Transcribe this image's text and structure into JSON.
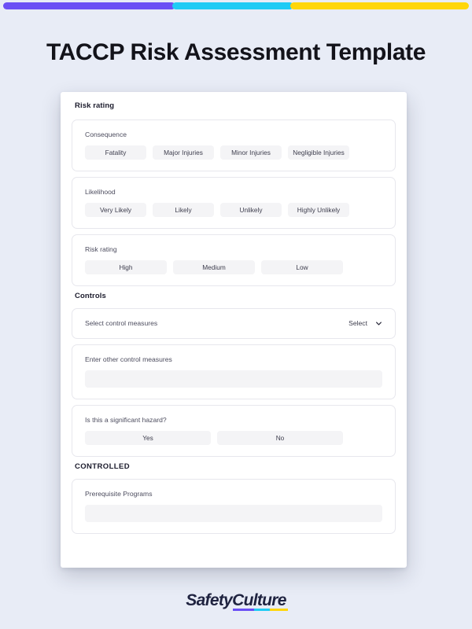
{
  "topbar": {
    "segments": [
      {
        "name": "purple",
        "color": "#6a4ff5"
      },
      {
        "name": "cyan",
        "color": "#1ecbf5"
      },
      {
        "name": "yellow",
        "color": "#ffd60a"
      }
    ]
  },
  "page": {
    "title": "TACCP Risk Assessment Template"
  },
  "document": {
    "sections": [
      {
        "heading": "Risk rating",
        "fields": [
          {
            "label": "Consequence",
            "type": "options",
            "options": [
              "Fatality",
              "Major Injuries",
              "Minor Injuries",
              "Negligible Injuries"
            ]
          },
          {
            "label": "Likelihood",
            "type": "options",
            "options": [
              "Very Likely",
              "Likely",
              "Unlikely",
              "Highly Unlikely"
            ]
          },
          {
            "label": "Risk rating",
            "type": "options",
            "options": [
              "High",
              "Medium",
              "Low"
            ]
          }
        ]
      },
      {
        "heading": "Controls",
        "fields": [
          {
            "label": "Select control measures",
            "type": "select",
            "value": "Select",
            "icon": "chevron-down-icon"
          },
          {
            "label": "Enter other control measures",
            "type": "text",
            "value": ""
          },
          {
            "label": "Is this a significant hazard?",
            "type": "options",
            "options": [
              "Yes",
              "No"
            ]
          }
        ]
      },
      {
        "heading": "CONTROLLED",
        "fields": [
          {
            "label": "Prerequisite Programs",
            "type": "text",
            "value": ""
          }
        ]
      }
    ]
  },
  "footer": {
    "brand_part1": "Safety",
    "brand_part2": "Culture"
  }
}
